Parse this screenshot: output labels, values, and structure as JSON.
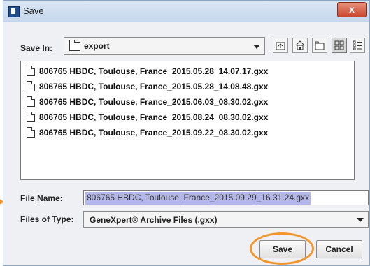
{
  "window": {
    "title": "Save",
    "close_label": "x"
  },
  "toolbar": {
    "save_in_label": "Save In:",
    "save_in_value": "export",
    "buttons": [
      "up-folder-icon",
      "home-icon",
      "new-folder-icon",
      "list-view-icon",
      "details-view-icon"
    ]
  },
  "files": [
    "806765 HBDC, Toulouse, France_2015.05.28_14.07.17.gxx",
    "806765 HBDC, Toulouse, France_2015.05.28_14.08.48.gxx",
    "806765 HBDC, Toulouse, France_2015.06.03_08.30.02.gxx",
    "806765 HBDC, Toulouse, France_2015.08.24_08.30.02.gxx",
    "806765 HBDC, Toulouse, France_2015.09.22_08.30.02.gxx"
  ],
  "form": {
    "file_name_label_pre": "File ",
    "file_name_label_u": "N",
    "file_name_label_post": "ame:",
    "file_name_value": "806765 HBDC, Toulouse, France_2015.09.29_16.31.24.gxx",
    "file_type_label_pre": "Files of ",
    "file_type_label_u": "T",
    "file_type_label_post": "ype:",
    "file_type_value": "GeneXpert® Archive Files (.gxx)"
  },
  "actions": {
    "save_label": "Save",
    "cancel_label": "Cancel"
  },
  "colors": {
    "highlight": "#f2962c",
    "selection": "#b3b6e8",
    "close": "#c9462c"
  }
}
